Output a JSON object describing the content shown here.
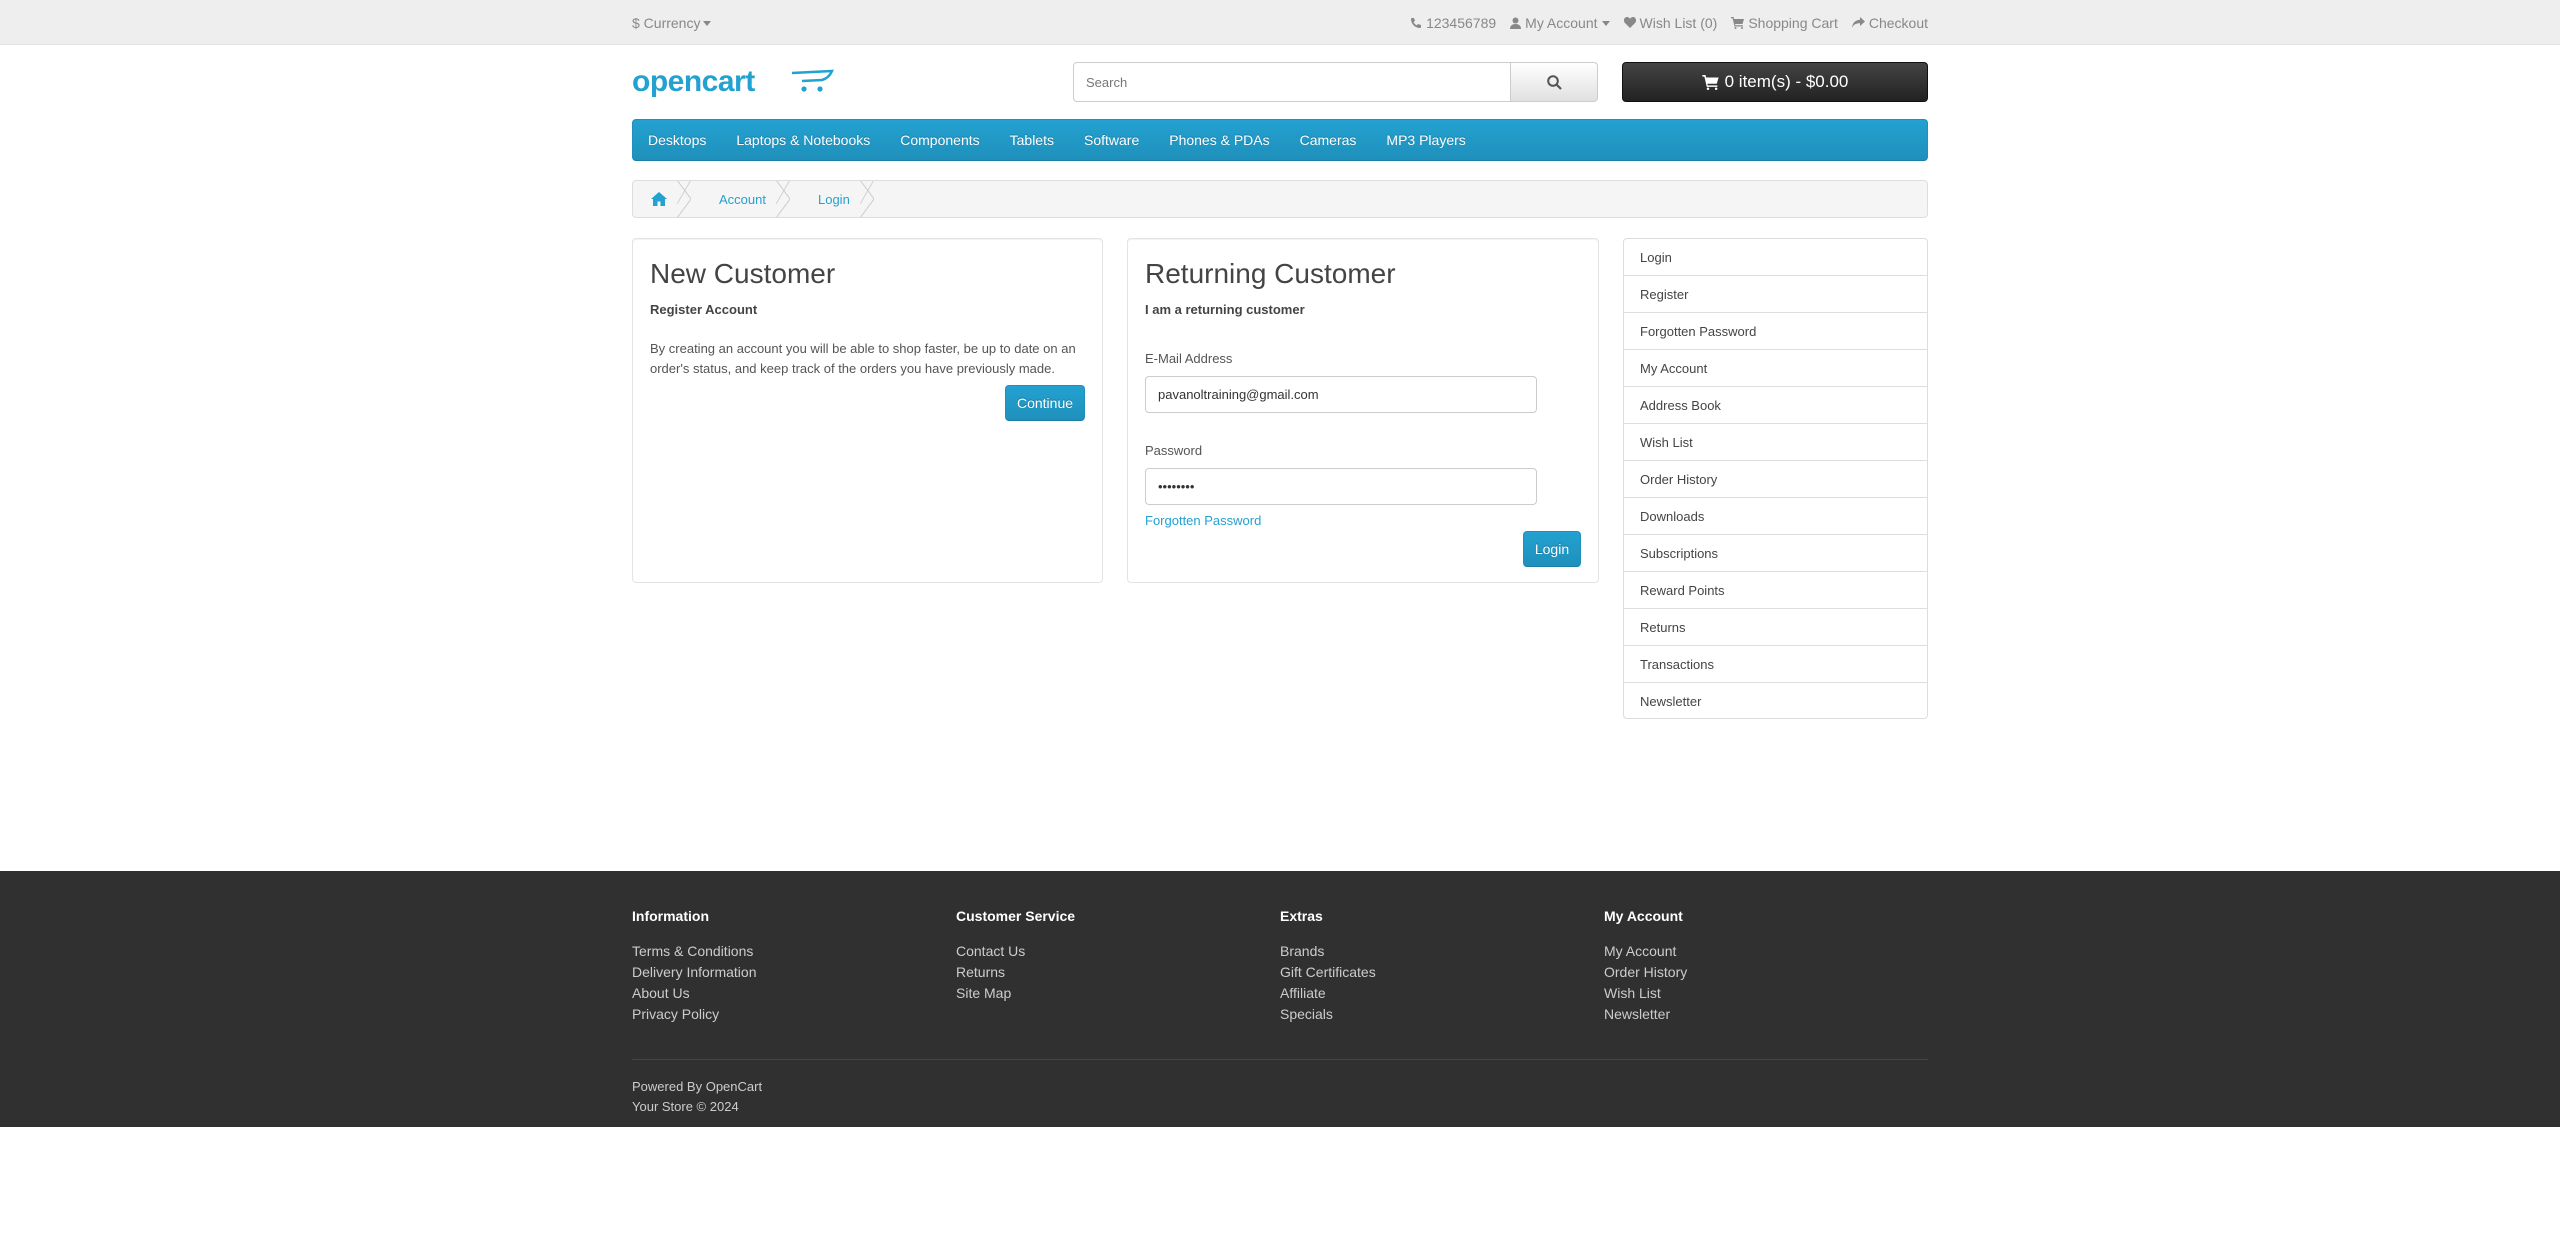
{
  "topbar": {
    "currency": "$ Currency",
    "phone": "123456789",
    "my_account": "My Account",
    "wish_list": "Wish List (0)",
    "shopping_cart": "Shopping Cart",
    "checkout": "Checkout"
  },
  "header": {
    "logo_text": "opencart",
    "search_placeholder": "Search",
    "cart_label": "0 item(s) - $0.00"
  },
  "menu": [
    "Desktops",
    "Laptops & Notebooks",
    "Components",
    "Tablets",
    "Software",
    "Phones & PDAs",
    "Cameras",
    "MP3 Players"
  ],
  "breadcrumb": [
    "Account",
    "Login"
  ],
  "new_customer": {
    "title": "New Customer",
    "subtitle": "Register Account",
    "body": "By creating an account you will be able to shop faster, be up to date on an order's status, and keep track of the orders you have previously made.",
    "button": "Continue"
  },
  "returning_customer": {
    "title": "Returning Customer",
    "subtitle": "I am a returning customer",
    "email_label": "E-Mail Address",
    "email_value": "pavanoltraining@gmail.com",
    "password_label": "Password",
    "password_value": "••••••••",
    "forgot_link": "Forgotten Password",
    "button": "Login"
  },
  "sidebar": [
    "Login",
    "Register",
    "Forgotten Password",
    "My Account",
    "Address Book",
    "Wish List",
    "Order History",
    "Downloads",
    "Subscriptions",
    "Reward Points",
    "Returns",
    "Transactions",
    "Newsletter"
  ],
  "footer": {
    "columns": [
      {
        "title": "Information",
        "links": [
          "Terms & Conditions",
          "Delivery Information",
          "About Us",
          "Privacy Policy"
        ]
      },
      {
        "title": "Customer Service",
        "links": [
          "Contact Us",
          "Returns",
          "Site Map"
        ]
      },
      {
        "title": "Extras",
        "links": [
          "Brands",
          "Gift Certificates",
          "Affiliate",
          "Specials"
        ]
      },
      {
        "title": "My Account",
        "links": [
          "My Account",
          "Order History",
          "Wish List",
          "Newsletter"
        ]
      }
    ],
    "powered_prefix": "Powered By",
    "powered_link": "OpenCart",
    "copyright": "Your Store © 2024"
  },
  "colors": {
    "accent": "#23a1d1",
    "footer_bg": "#303030",
    "cart_bg": "#222222"
  }
}
